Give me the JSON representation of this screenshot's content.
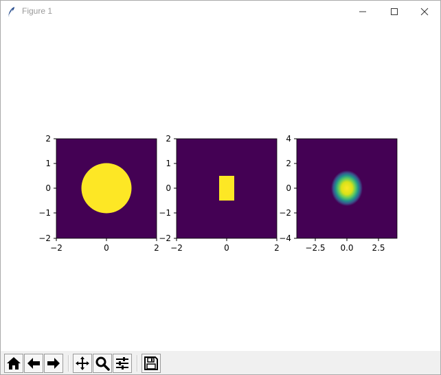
{
  "window": {
    "title": "Figure 1",
    "icons": {
      "app": "feather-icon",
      "minimize": "minimize-icon",
      "maximize": "maximize-icon",
      "close": "close-icon"
    }
  },
  "colors": {
    "viridis_low": "#440154",
    "viridis_high": "#fde725",
    "viridis_mid_teal": "#21918c",
    "viridis_mid_green": "#5ec962",
    "toolbar_bg": "#f0f0f0"
  },
  "plots": [
    {
      "name": "circle",
      "type": "image",
      "description_shape": "disk",
      "xticks": [
        "−2",
        "0",
        "2"
      ],
      "yticks": [
        "2",
        "1",
        "0",
        "−1",
        "−2"
      ],
      "xlim": [
        -2,
        2
      ],
      "ylim": [
        -2,
        2
      ],
      "shape": {
        "kind": "circle",
        "cx": 0,
        "cy": 0,
        "r": 1
      }
    },
    {
      "name": "rectangle",
      "type": "image",
      "xticks": [
        "−2",
        "0",
        "2"
      ],
      "yticks": [
        "2",
        "1",
        "0",
        "−1",
        "−2"
      ],
      "xlim": [
        -2,
        2
      ],
      "ylim": [
        -2,
        2
      ],
      "shape": {
        "kind": "rect",
        "x0": -0.3,
        "x1": 0.3,
        "y0": -0.5,
        "y1": 0.5
      }
    },
    {
      "name": "gaussian",
      "type": "image",
      "xticks": [
        "−2.5",
        "0.0",
        "2.5"
      ],
      "yticks": [
        "4",
        "2",
        "0",
        "−2",
        "−4"
      ],
      "xlim": [
        -4,
        4
      ],
      "ylim": [
        -4,
        4
      ],
      "shape": {
        "kind": "blur-ellipse",
        "cx": 0,
        "cy": 0,
        "rx": 1.0,
        "ry": 1.1
      }
    }
  ],
  "toolbar": {
    "buttons": [
      {
        "icon": "home-icon"
      },
      {
        "icon": "back-arrow-icon"
      },
      {
        "icon": "forward-arrow-icon"
      },
      {
        "icon": "pan-icon"
      },
      {
        "icon": "zoom-icon"
      },
      {
        "icon": "configure-subplots-icon"
      },
      {
        "icon": "save-icon"
      }
    ]
  }
}
